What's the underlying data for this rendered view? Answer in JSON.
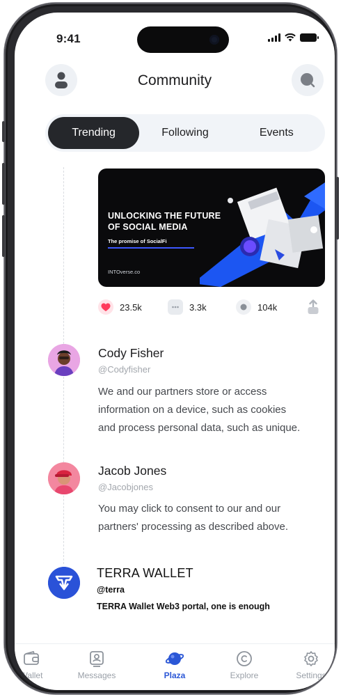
{
  "status_bar": {
    "time": "9:41"
  },
  "header": {
    "title": "Community"
  },
  "tabs": [
    {
      "label": "Trending",
      "active": true
    },
    {
      "label": "Following",
      "active": false
    },
    {
      "label": "Events",
      "active": false
    }
  ],
  "banner": {
    "title": "UNLOCKING THE FUTURE OF SOCIAL MEDIA",
    "subtitle": "The promise of SocialFi",
    "brand": "INTOverse.co"
  },
  "stats": {
    "likes": "23.5k",
    "comments": "3.3k",
    "views": "104k"
  },
  "posts": [
    {
      "name": "Cody Fisher",
      "handle": "@Codyfisher",
      "lines": [
        "We and our partners store or access",
        "information on a device, such as cookies",
        "and process personal data, such as unique."
      ]
    },
    {
      "name": "Jacob Jones",
      "handle": "@Jacobjones",
      "lines": [
        "You may click to consent to our and our",
        "partners' processing as described above."
      ]
    }
  ],
  "terra": {
    "name": "TERRA WALLET",
    "handle": "@terra",
    "text": "TERRA Wallet  Web3 portal, one is enough"
  },
  "nav": [
    {
      "label": "Wallet",
      "icon": "wallet-icon",
      "active": false
    },
    {
      "label": "Messages",
      "icon": "messages-icon",
      "active": false
    },
    {
      "label": "Plaza",
      "icon": "plaza-icon",
      "active": true
    },
    {
      "label": "Explore",
      "icon": "explore-icon",
      "active": false
    },
    {
      "label": "Settings",
      "icon": "settings-icon",
      "active": false
    }
  ],
  "colors": {
    "accent": "#2b57d6",
    "like": "#ff3b5c",
    "tab_active": "#25272b"
  }
}
